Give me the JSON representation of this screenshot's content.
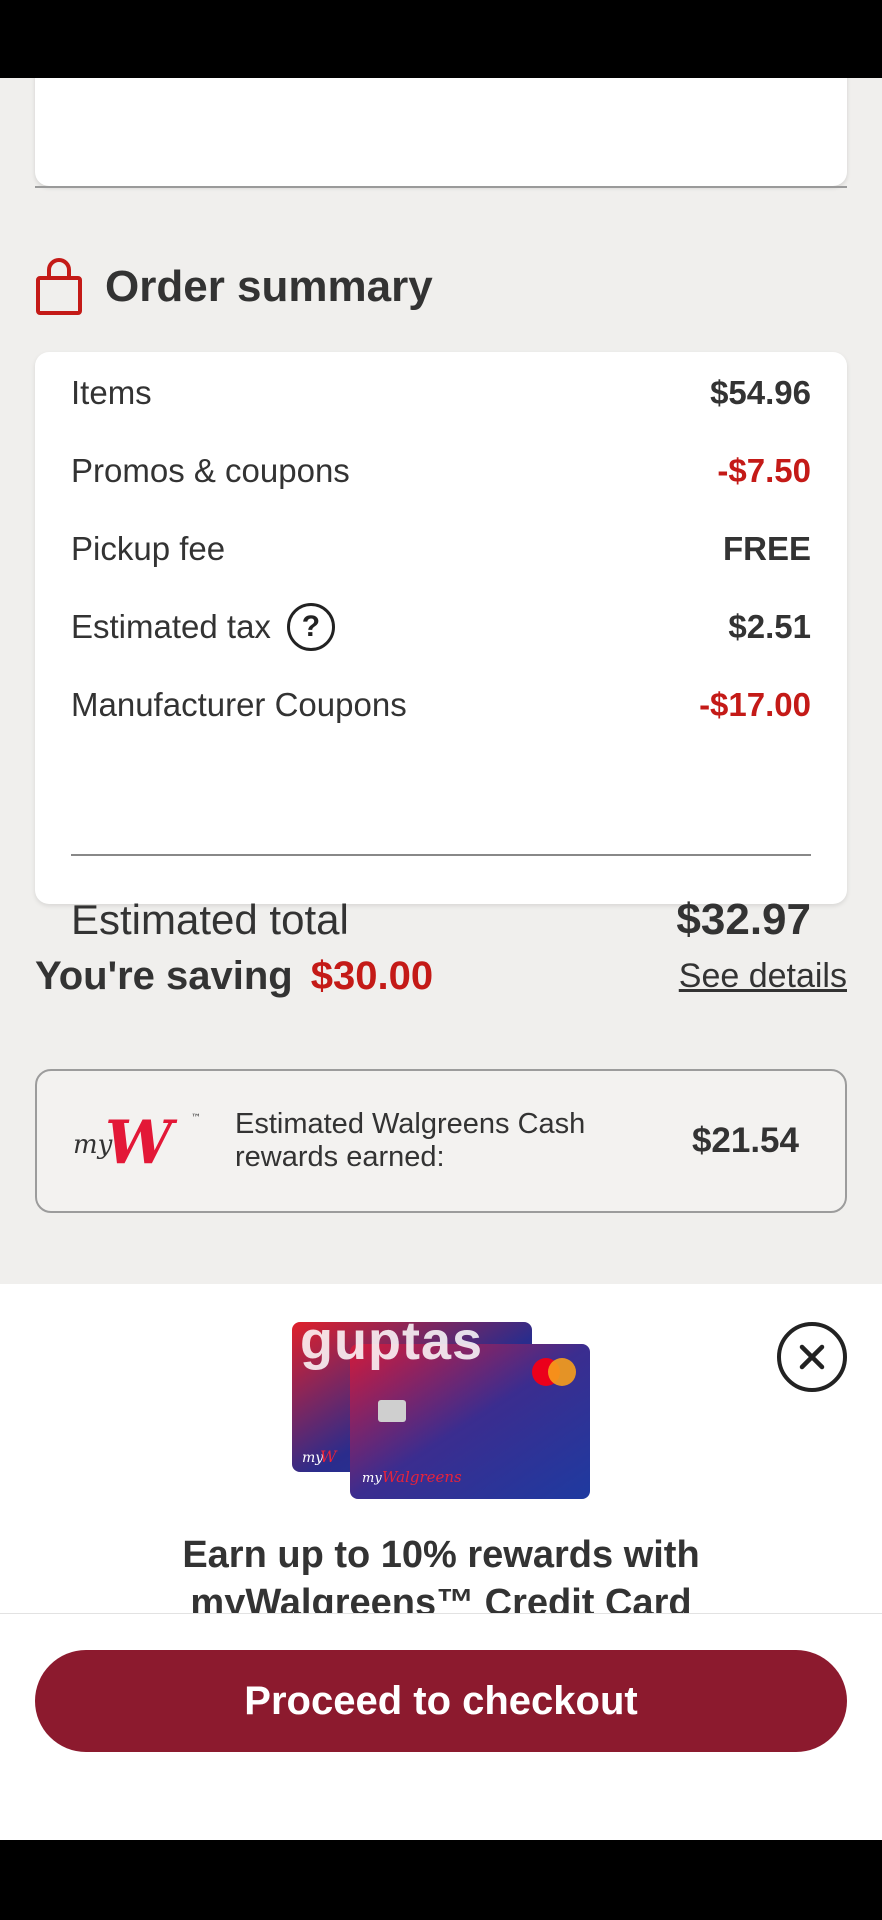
{
  "order_summary": {
    "title": "Order summary",
    "lines": [
      {
        "label": "Items",
        "value": "$54.96",
        "color": "#333333"
      },
      {
        "label": "Promos & coupons",
        "value": "-$7.50",
        "color": "#c41a17"
      },
      {
        "label": "Pickup fee",
        "value": "FREE",
        "color": "#333333"
      },
      {
        "label": "Estimated tax",
        "value": "$2.51",
        "color": "#333333",
        "help_icon": "?"
      },
      {
        "label": "Manufacturer Coupons",
        "value": "-$17.00",
        "color": "#c41a17"
      }
    ],
    "total_label": "Estimated total",
    "total_value": "$32.97"
  },
  "savings": {
    "label": "You're saving",
    "amount": "$30.00",
    "details_link": "See details"
  },
  "rewards": {
    "logo": "myW",
    "text": "Estimated Walgreens Cash rewards earned:",
    "amount": "$21.54"
  },
  "promo": {
    "watermark": "guptas",
    "card_brand": "myWalgreens",
    "text_line1": "Earn up to 10% rewards with",
    "text_line2": "myWalgreens™ Credit Card"
  },
  "checkout": {
    "button_label": "Proceed to checkout"
  },
  "colors": {
    "brand_red": "#c41a17",
    "checkout_button": "#8c1a2e",
    "background": "#f0efed"
  }
}
